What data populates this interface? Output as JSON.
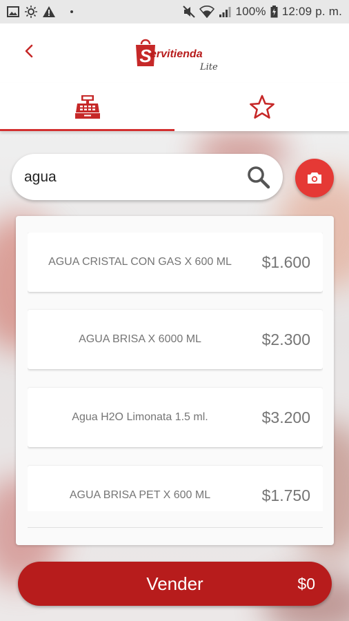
{
  "status_bar": {
    "battery": "100%",
    "time": "12:09 p. m."
  },
  "header": {
    "logo_text": "ervitienda",
    "logo_letter": "S",
    "logo_subtitle": "Lite"
  },
  "tabs": [
    {
      "name": "cash-register",
      "icon": "cash-register-icon",
      "active": true
    },
    {
      "name": "favorites",
      "icon": "star-icon",
      "active": false
    }
  ],
  "search": {
    "value": "agua"
  },
  "products": [
    {
      "name": "AGUA CRISTAL CON GAS X 600 ML",
      "price": "$1.600"
    },
    {
      "name": "AGUA BRISA X 6000 ML",
      "price": "$2.300"
    },
    {
      "name": "Agua H2O Limonata 1.5 ml.",
      "price": "$3.200"
    },
    {
      "name": "AGUA BRISA PET X 600 ML",
      "price": "$1.750"
    }
  ],
  "sell_button": {
    "label": "Vender",
    "total": "$0"
  },
  "colors": {
    "accent": "#d32f2f",
    "button": "#b71c1c",
    "camera": "#e53935"
  }
}
